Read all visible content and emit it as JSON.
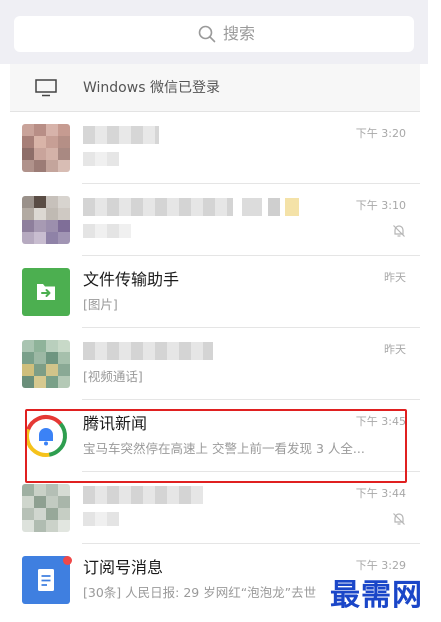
{
  "search": {
    "label": "搜索",
    "icon": "search-icon"
  },
  "device_bar": {
    "text": "Windows 微信已登录",
    "icon": "monitor-icon"
  },
  "chats": [
    {
      "name": "",
      "preview": "",
      "time": "下午 3:20",
      "muted": false,
      "avatar": "pixelated"
    },
    {
      "name": "",
      "preview": "",
      "time": "下午 3:10",
      "muted": true,
      "avatar": "pixelated"
    },
    {
      "name": "文件传输助手",
      "preview": "[图片]",
      "time": "昨天",
      "muted": false,
      "avatar": "file-transfer-icon"
    },
    {
      "name": "",
      "preview": "[视频通话]",
      "time": "昨天",
      "muted": false,
      "avatar": "pixelated"
    },
    {
      "name": "腾讯新闻",
      "preview": "宝马车突然停在高速上 交警上前一看发现 3 人全...",
      "time": "下午 3:45",
      "muted": false,
      "avatar": "tencent-news-icon"
    },
    {
      "name": "",
      "preview": "",
      "time": "下午 3:44",
      "muted": true,
      "avatar": "pixelated"
    },
    {
      "name": "订阅号消息",
      "preview": "[30条] 人民日报: 29 岁网红“泡泡龙”去世",
      "time": "下午 3:29",
      "muted": false,
      "avatar": "subscription-icon"
    }
  ],
  "watermark": "最需网",
  "colors": {
    "highlight": "#e02020",
    "file_transfer": "#4caf50",
    "subscription": "#3f7fe0",
    "watermark": "#1a46c8"
  }
}
